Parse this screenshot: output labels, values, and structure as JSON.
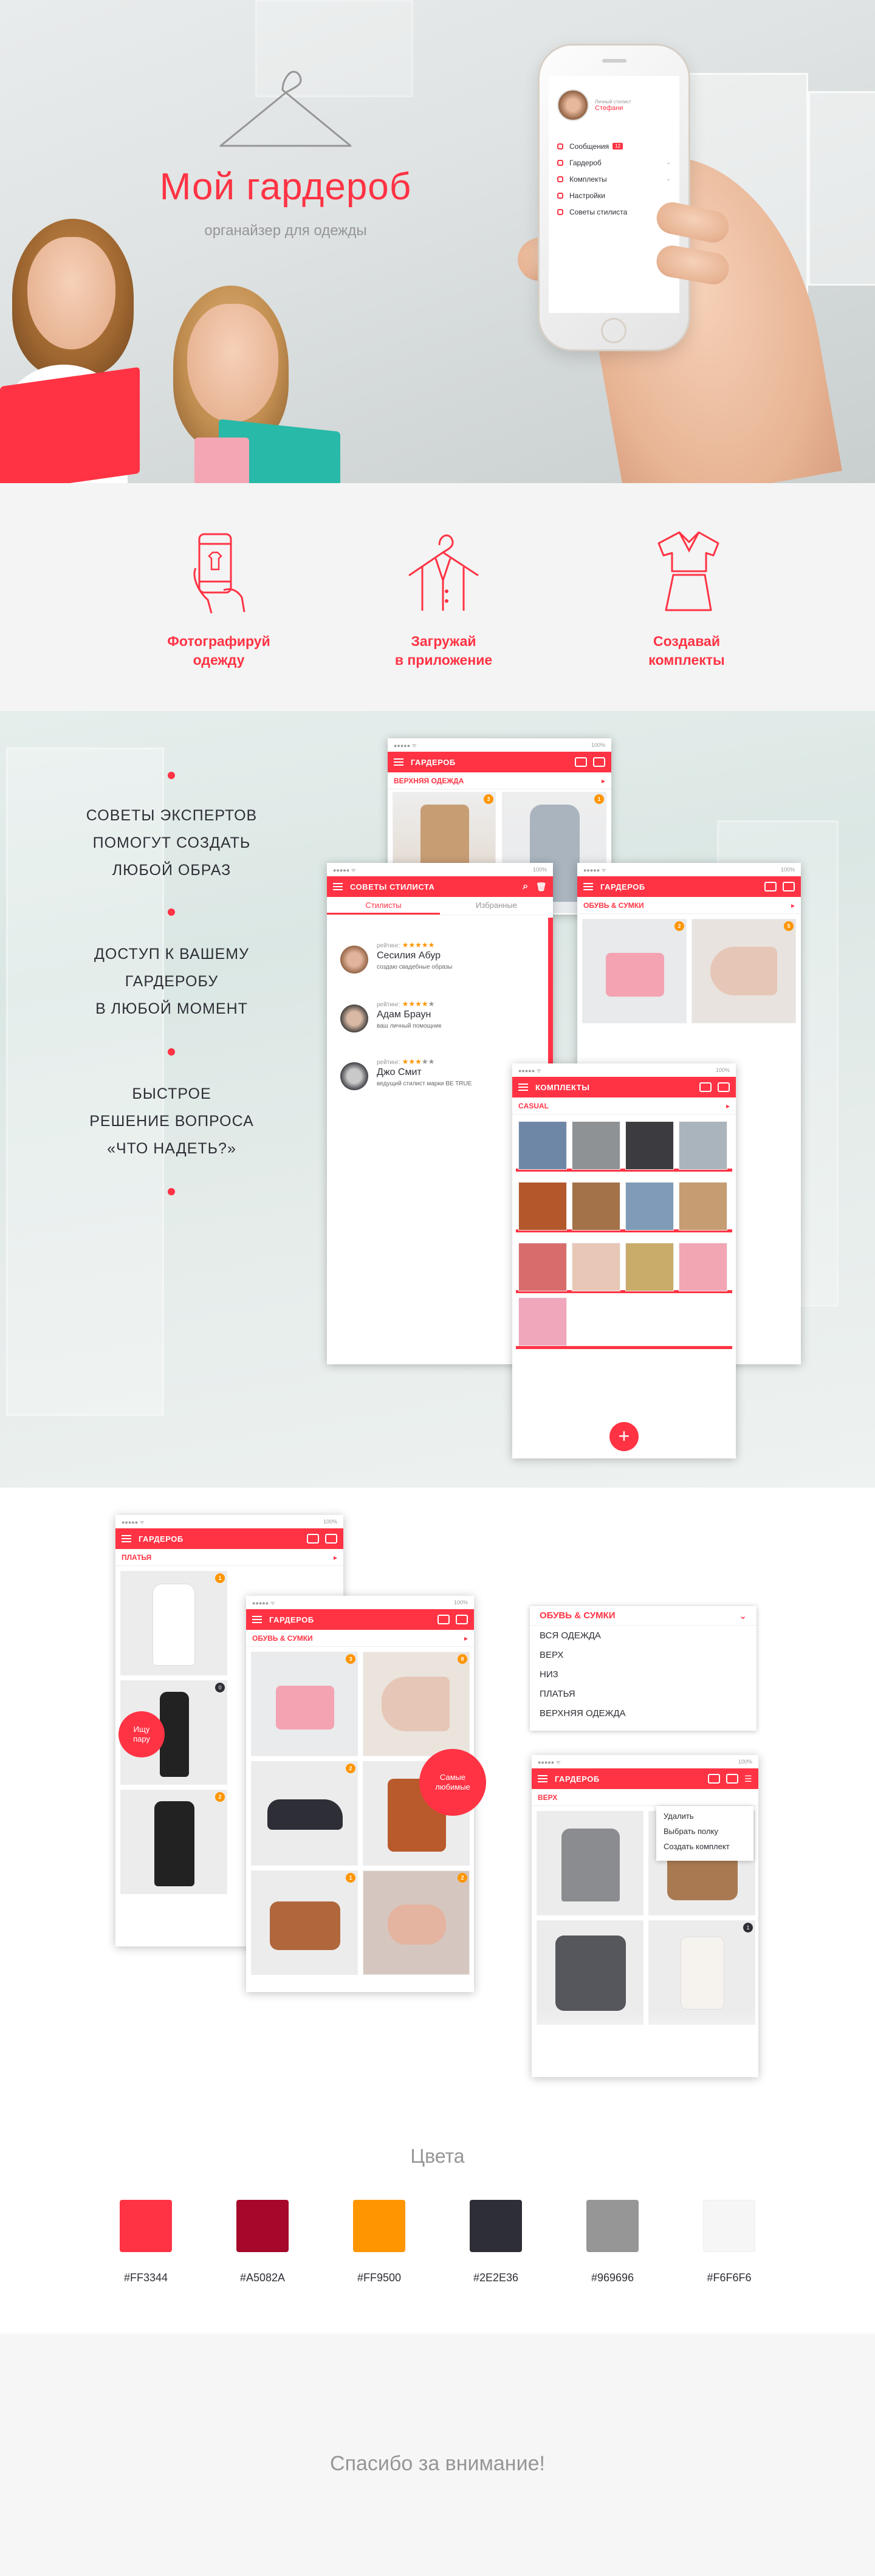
{
  "hero": {
    "title": "Мой гардероб",
    "subtitle": "органайзер для одежды",
    "phone": {
      "user_role": "Личный стилист",
      "user_name": "Стефани",
      "menu": [
        {
          "label": "Сообщения",
          "icon": "message-icon",
          "badge": "12"
        },
        {
          "label": "Гардероб",
          "icon": "hanger-icon"
        },
        {
          "label": "Комплекты",
          "icon": "outfit-icon"
        },
        {
          "label": "Настройки",
          "icon": "gear-icon"
        },
        {
          "label": "Советы стилиста",
          "icon": "chat-icon"
        }
      ]
    }
  },
  "features": [
    {
      "label": "Фотографируй одежду",
      "line1": "Фотографируй",
      "line2": "одежду",
      "icon": "phone-shirt-icon"
    },
    {
      "label": "Загружай в приложение",
      "line1": "Загружай",
      "line2": "в приложение",
      "icon": "hanger-upload-icon"
    },
    {
      "label": "Создавай комплекты",
      "line1": "Создавай",
      "line2": "комплекты",
      "icon": "dress-icon"
    }
  ],
  "benefits": [
    {
      "l1": "СОВЕТЫ ЭКСПЕРТОВ",
      "l2": "ПОМОГУТ СОЗДАТЬ",
      "l3": "ЛЮБОЙ ОБРАЗ"
    },
    {
      "l1": "ДОСТУП К ВАШЕМУ",
      "l2": "ГАРДЕРОБУ",
      "l3": "В ЛЮБОЙ МОМЕНТ"
    },
    {
      "l1": "БЫСТРОЕ",
      "l2": "РЕШЕНИЕ ВОПРОСА",
      "l3": "«ЧТО НАДЕТЬ?»"
    }
  ],
  "status_bar": {
    "carrier": "●●●●● ᯤ",
    "battery": "100%"
  },
  "screens": {
    "wardrobe_title": "ГАРДЕРОБ",
    "outerwear": "ВЕРХНЯЯ ОДЕЖДА",
    "shoes_bags": "ОБУВЬ & СУМКИ",
    "dresses": "ПЛАТЬЯ",
    "top": "ВЕРХ",
    "outfits_title": "КОМПЛЕКТЫ",
    "casual": "CASUAL",
    "stylist_title": "СОВЕТЫ СТИЛИСТА",
    "tab_stylists": "Стилисты",
    "tab_favorites": "Избранные",
    "rating_label": "рейтинг:",
    "stylists": [
      {
        "name": "Сесилия Абур",
        "desc": "создаю свадебные образы",
        "rating": 5
      },
      {
        "name": "Адам Браун",
        "desc": "ваш личный помощник",
        "rating": 4
      },
      {
        "name": "Джо Смит",
        "desc": "ведущий стилист марки BE TRUE",
        "rating": 3
      }
    ],
    "badges": {
      "b1": "3",
      "b2": "1",
      "b3": "2",
      "b4": "5",
      "b5": "1",
      "b6": "2",
      "b7": "3",
      "b8": "2",
      "b9": "0",
      "b10": "1",
      "b11": "2",
      "b12": "8",
      "b13": "3",
      "b14": "4",
      "b15": "2",
      "b16": "3",
      "b17": "1"
    },
    "add_label": "+"
  },
  "callouts": {
    "pair": "Ищу пару",
    "pair_l1": "Ищу",
    "pair_l2": "пару",
    "favorite": "Самые любимые",
    "fav_l1": "Самые",
    "fav_l2": "любимые"
  },
  "dropdown": {
    "selected": "ОБУВЬ & СУМКИ",
    "options": [
      "ВСЯ ОДЕЖДА",
      "ВЕРХ",
      "НИЗ",
      "ПЛАТЬЯ",
      "ВЕРХНЯЯ ОДЕЖДА"
    ]
  },
  "context_menu": [
    "Удалить",
    "Выбрать полку",
    "Создать комплект"
  ],
  "colors_section": {
    "title": "Цвета",
    "swatches": [
      {
        "hex": "#FF3344",
        "label": "#FF3344"
      },
      {
        "hex": "#A5082A",
        "label": "#A5082A"
      },
      {
        "hex": "#FF9500",
        "label": "#FF9500"
      },
      {
        "hex": "#2E2E36",
        "label": "#2E2E36"
      },
      {
        "hex": "#969696",
        "label": "#969696"
      },
      {
        "hex": "#F6F6F6",
        "label": "#F6F6F6"
      }
    ]
  },
  "footer": {
    "thanks": "Спасибо за внимание!"
  }
}
